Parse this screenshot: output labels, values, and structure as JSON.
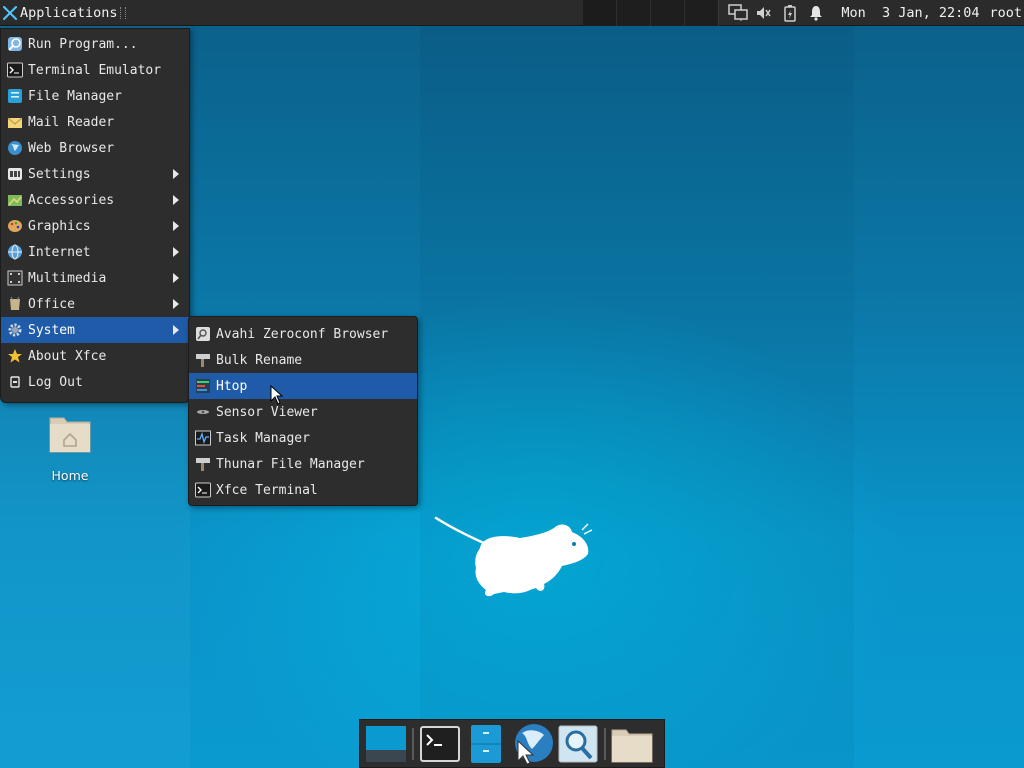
{
  "panel": {
    "apps_label": "Applications",
    "clock": "Mon  3 Jan, 22:04",
    "user": "root",
    "tray_icons": [
      "network-icon",
      "volume-icon",
      "battery-icon",
      "notification-bell-icon"
    ]
  },
  "menu": {
    "items": [
      {
        "label": "Run Program...",
        "icon": "run-program-icon",
        "submenu": false
      },
      {
        "label": "Terminal Emulator",
        "icon": "terminal-icon",
        "submenu": false
      },
      {
        "label": "File Manager",
        "icon": "file-manager-icon",
        "submenu": false
      },
      {
        "label": "Mail Reader",
        "icon": "mail-icon",
        "submenu": false
      },
      {
        "label": "Web Browser",
        "icon": "web-browser-icon",
        "submenu": false
      },
      {
        "label": "Settings",
        "icon": "settings-icon",
        "submenu": true
      },
      {
        "label": "Accessories",
        "icon": "accessories-icon",
        "submenu": true
      },
      {
        "label": "Graphics",
        "icon": "graphics-icon",
        "submenu": true
      },
      {
        "label": "Internet",
        "icon": "internet-icon",
        "submenu": true
      },
      {
        "label": "Multimedia",
        "icon": "multimedia-icon",
        "submenu": true
      },
      {
        "label": "Office",
        "icon": "office-icon",
        "submenu": true
      },
      {
        "label": "System",
        "icon": "system-gear-icon",
        "submenu": true,
        "highlighted": true
      },
      {
        "label": "About Xfce",
        "icon": "star-icon",
        "submenu": false
      },
      {
        "label": "Log Out",
        "icon": "logout-icon",
        "submenu": false
      }
    ]
  },
  "submenu": {
    "parent": "System",
    "items": [
      {
        "label": "Avahi Zeroconf Browser",
        "icon": "avahi-icon"
      },
      {
        "label": "Bulk Rename",
        "icon": "bulk-rename-icon"
      },
      {
        "label": "Htop",
        "icon": "htop-icon",
        "highlighted": true
      },
      {
        "label": "Sensor Viewer",
        "icon": "sensor-icon"
      },
      {
        "label": "Task Manager",
        "icon": "task-manager-icon"
      },
      {
        "label": "Thunar File Manager",
        "icon": "thunar-icon"
      },
      {
        "label": "Xfce Terminal",
        "icon": "terminal-icon"
      }
    ]
  },
  "desktop": {
    "home_icon_label": "Home"
  },
  "dock": {
    "items": [
      "show-desktop-icon",
      "terminal-icon",
      "file-manager-icon",
      "web-browser-icon",
      "app-finder-icon",
      "folder-icon"
    ]
  },
  "colors": {
    "panel_bg": "#2b2b2b",
    "menu_bg": "#2d2d2d",
    "highlight": "#1f5ba8",
    "desktop_blue": "#0a93c8"
  }
}
